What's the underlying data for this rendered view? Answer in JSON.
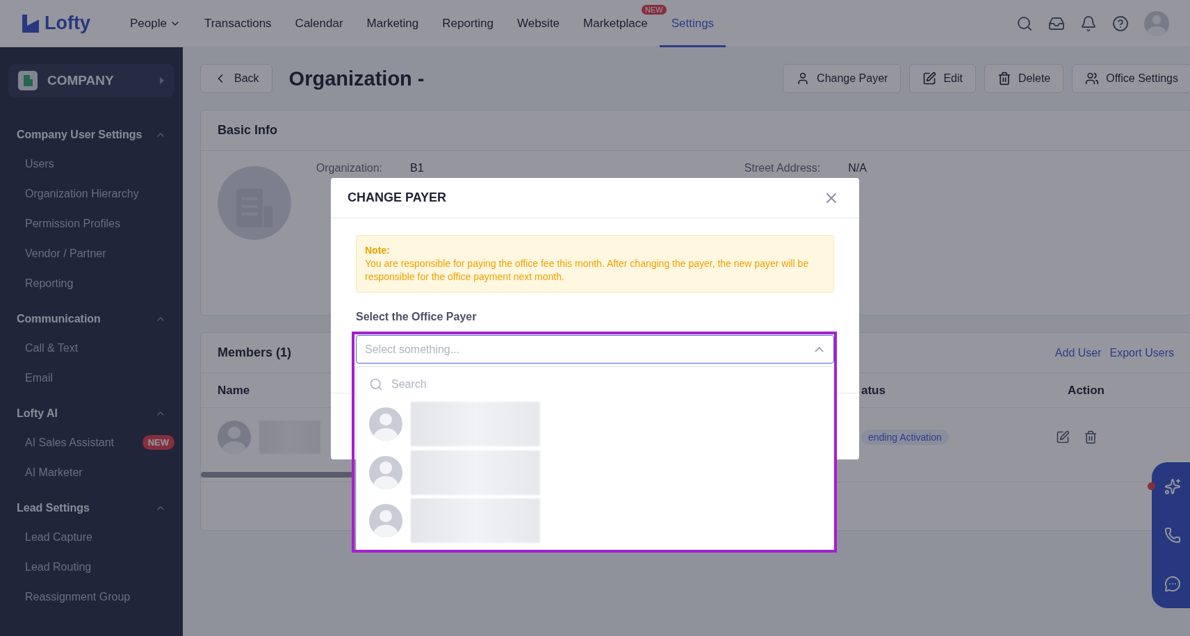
{
  "nav": {
    "logo": "Lofty",
    "items": [
      {
        "label": "People",
        "dropdown": true,
        "selected": false
      },
      {
        "label": "Transactions",
        "selected": false
      },
      {
        "label": "Calendar",
        "selected": false
      },
      {
        "label": "Marketing",
        "selected": false
      },
      {
        "label": "Reporting",
        "selected": false
      },
      {
        "label": "Website",
        "selected": false
      },
      {
        "label": "Marketplace",
        "badge": "NEW",
        "selected": false
      },
      {
        "label": "Settings",
        "selected": true
      }
    ]
  },
  "sidebar": {
    "company": "COMPANY",
    "sections": [
      {
        "title": "Company User Settings",
        "expanded": true,
        "items": [
          {
            "label": "Users"
          },
          {
            "label": "Organization Hierarchy"
          },
          {
            "label": "Permission Profiles"
          },
          {
            "label": "Vendor / Partner"
          },
          {
            "label": "Reporting"
          }
        ]
      },
      {
        "title": "Communication",
        "expanded": true,
        "items": [
          {
            "label": "Call & Text"
          },
          {
            "label": "Email"
          }
        ]
      },
      {
        "title": "Lofty AI",
        "expanded": true,
        "items": [
          {
            "label": "AI Sales Assistant",
            "badge": "NEW"
          },
          {
            "label": "AI Marketer"
          }
        ]
      },
      {
        "title": "Lead Settings",
        "expanded": true,
        "items": [
          {
            "label": "Lead Capture"
          },
          {
            "label": "Lead Routing"
          },
          {
            "label": "Reassignment Group"
          }
        ]
      }
    ]
  },
  "header": {
    "back": "Back",
    "title": "Organization -",
    "actions": [
      "Change Payer",
      "Edit",
      "Delete",
      "Office Settings"
    ]
  },
  "basic_info": {
    "title": "Basic Info",
    "fields": [
      {
        "label": "Organization:",
        "value": "B1"
      },
      {
        "label": "Street Address:",
        "value": "N/A"
      }
    ]
  },
  "members": {
    "title": "Members (1)",
    "links": [
      "Add User",
      "Export Users"
    ],
    "columns": [
      "Name",
      "atus",
      "Action"
    ],
    "rows": [
      {
        "redacted": true,
        "status": "ending Activation"
      }
    ]
  },
  "modal": {
    "title": "CHANGE PAYER",
    "note_title": "Note:",
    "note_text": "You are responsible for paying the office fee this month. After changing the payer, the new payer will be responsible for the office payment next month.",
    "field_label": "Select the Office Payer",
    "select": {
      "placeholder": "Select something...",
      "expanded": true
    },
    "search": {
      "placeholder": "Search"
    },
    "options": [
      {
        "redacted": true
      },
      {
        "redacted": true
      },
      {
        "redacted": true
      }
    ]
  }
}
